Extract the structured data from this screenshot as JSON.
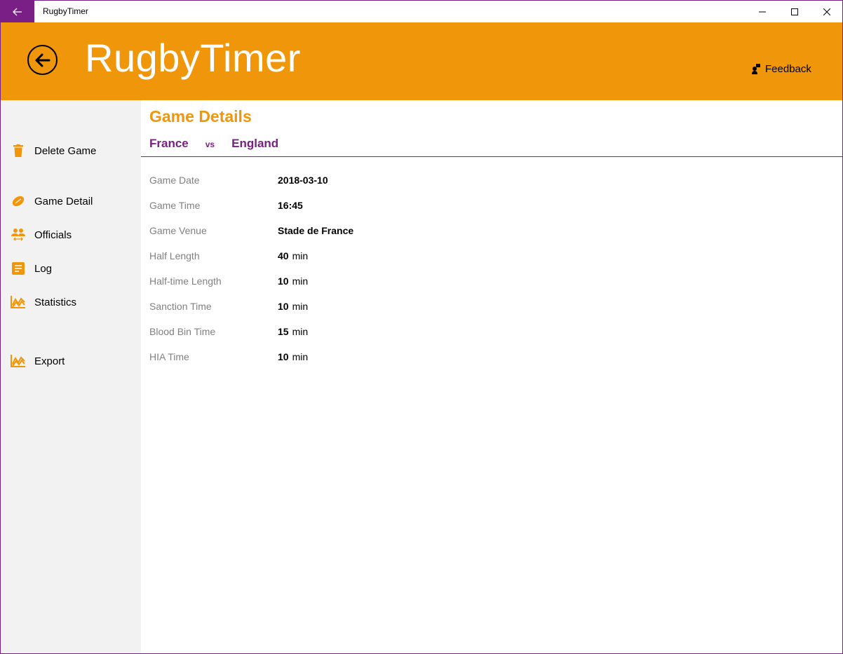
{
  "window": {
    "title": "RugbyTimer"
  },
  "header": {
    "app_title": "RugbyTimer",
    "feedback_label": "Feedback"
  },
  "sidebar": {
    "items": [
      {
        "label": "Delete Game",
        "icon": "trash-icon"
      },
      {
        "label": "Game Detail",
        "icon": "rugby-ball-icon"
      },
      {
        "label": "Officials",
        "icon": "officials-icon"
      },
      {
        "label": "Log",
        "icon": "log-icon"
      },
      {
        "label": "Statistics",
        "icon": "statistics-icon"
      },
      {
        "label": "Export",
        "icon": "export-icon"
      }
    ]
  },
  "main": {
    "page_title": "Game Details",
    "home_team": "France",
    "vs_label": "vs",
    "away_team": "England",
    "details": [
      {
        "label": "Game Date",
        "value": "2018-03-10",
        "unit": ""
      },
      {
        "label": "Game Time",
        "value": "16:45",
        "unit": ""
      },
      {
        "label": "Game Venue",
        "value": "Stade de France",
        "unit": ""
      },
      {
        "label": "Half Length",
        "value": "40",
        "unit": "min"
      },
      {
        "label": "Half-time Length",
        "value": "10",
        "unit": "min"
      },
      {
        "label": "Sanction Time",
        "value": "10",
        "unit": "min"
      },
      {
        "label": "Blood Bin Time",
        "value": "15",
        "unit": "min"
      },
      {
        "label": "HIA Time",
        "value": "10",
        "unit": "min"
      }
    ]
  },
  "colors": {
    "accent_orange": "#f0960a",
    "accent_purple": "#7a1f86"
  }
}
